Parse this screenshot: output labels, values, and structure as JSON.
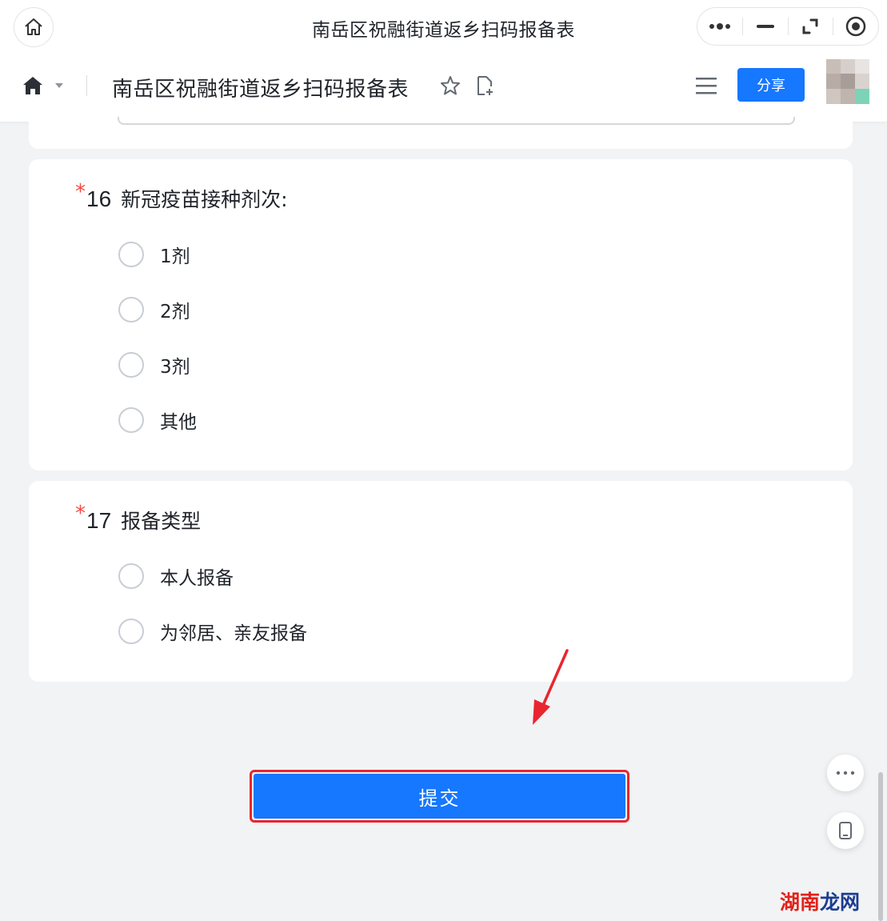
{
  "titlebar": {
    "title": "南岳区祝融街道返乡扫码报备表",
    "capsule_icons": [
      "more-dots-icon",
      "minimize-icon",
      "restore-icon",
      "close-circle-icon"
    ]
  },
  "appbar": {
    "title": "南岳区祝融街道返乡扫码报备表",
    "share_label": "分享"
  },
  "questions": [
    {
      "required_mark": "*",
      "number": "16",
      "title": "新冠疫苗接种剂次:",
      "options": [
        "1剂",
        "2剂",
        "3剂",
        "其他"
      ]
    },
    {
      "required_mark": "*",
      "number": "17",
      "title": "报备类型",
      "options": [
        "本人报备",
        "为邻居、亲友报备"
      ]
    }
  ],
  "submit_label": "提交",
  "watermark": {
    "part1": "湖南",
    "part2": "龙网"
  },
  "colors": {
    "primary": "#1677ff",
    "required": "#f54a45",
    "annotation": "#e8262f"
  }
}
